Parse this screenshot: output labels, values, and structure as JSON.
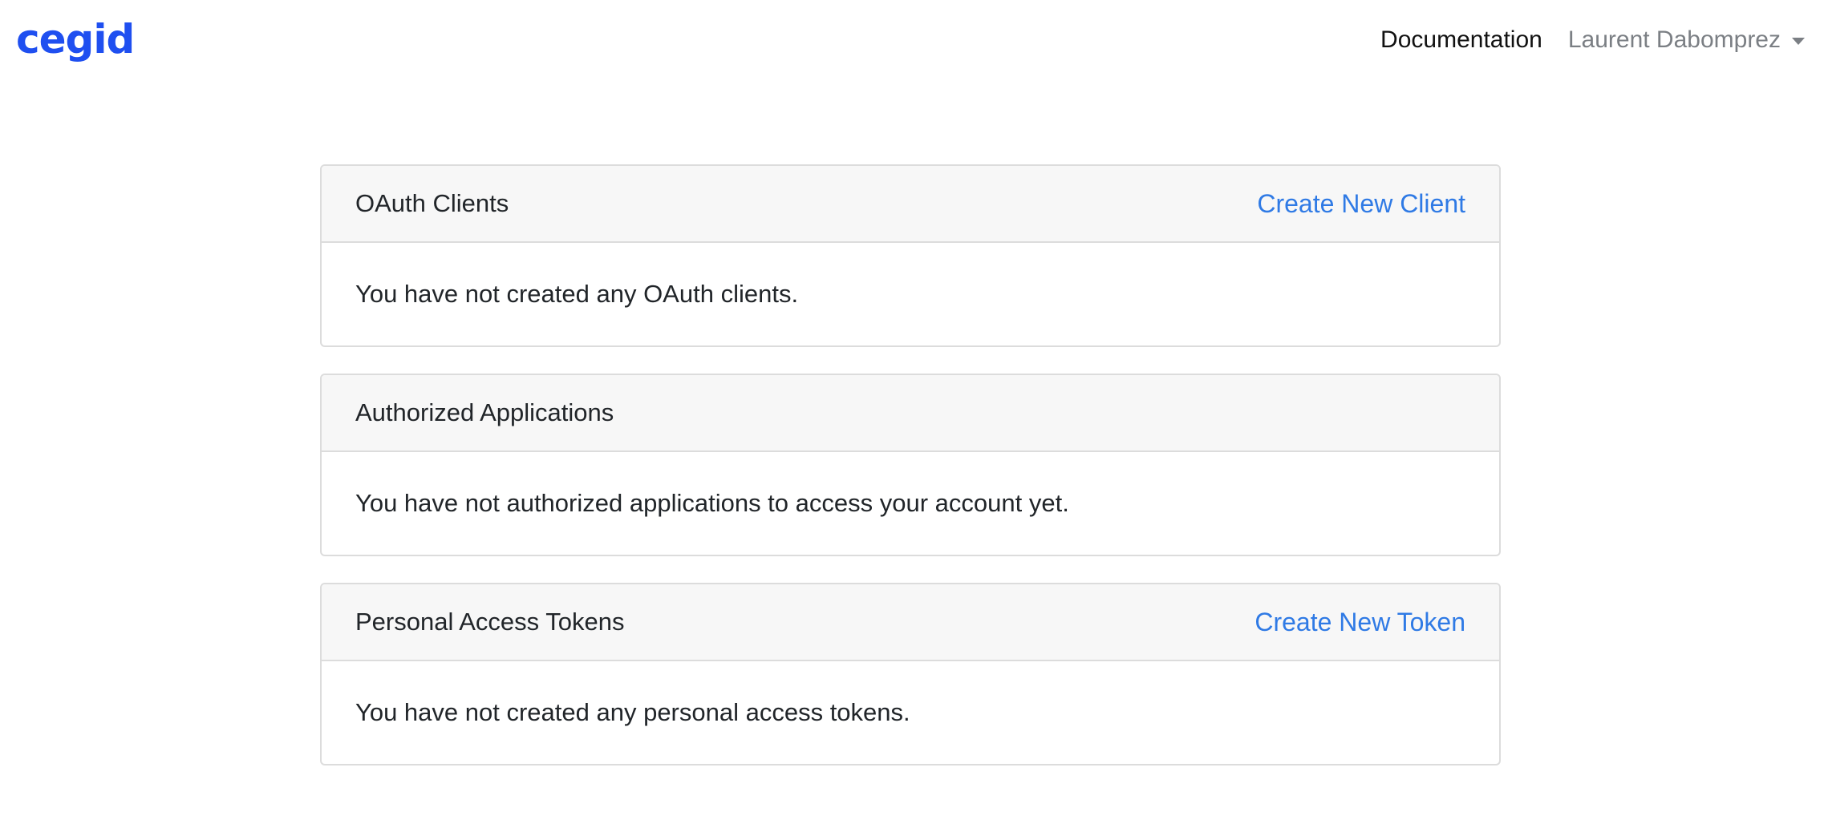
{
  "navbar": {
    "brand": "cegid",
    "documentation_label": "Documentation",
    "user_name": "Laurent Dabomprez"
  },
  "cards": {
    "oauth_clients": {
      "title": "OAuth Clients",
      "action_label": "Create New Client",
      "empty_message": "You have not created any OAuth clients."
    },
    "authorized_apps": {
      "title": "Authorized Applications",
      "empty_message": "You have not authorized applications to access your account yet."
    },
    "personal_tokens": {
      "title": "Personal Access Tokens",
      "action_label": "Create New Token",
      "empty_message": "You have not created any personal access tokens."
    }
  },
  "colors": {
    "brand": "#1f4ff0",
    "link": "#2f7ae5",
    "header_bg": "#f7f7f7",
    "border": "#dcdcdc"
  }
}
